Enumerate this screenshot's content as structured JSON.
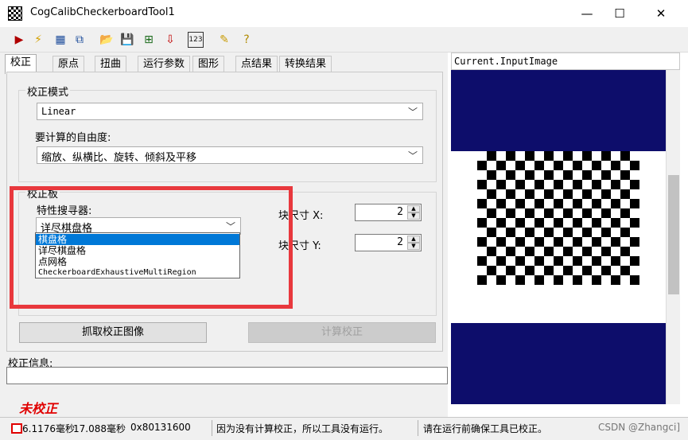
{
  "window": {
    "title": "CogCalibCheckerboardTool1",
    "minimize": "—",
    "maximize": "☐",
    "close": "✕"
  },
  "toolbar": {
    "buttons": [
      {
        "name": "run-icon",
        "glyph": "▶",
        "color": "#b00000"
      },
      {
        "name": "electric-icon",
        "glyph": "⚡",
        "color": "#d4a000"
      },
      {
        "name": "show-image-icon",
        "glyph": "▦",
        "color": "#1a4a9a"
      },
      {
        "name": "add-icon",
        "glyph": "⧉",
        "color": "#1a4a9a"
      },
      {
        "name": "open-folder-icon",
        "glyph": "📂",
        "color": "#c89a00"
      },
      {
        "name": "save-icon",
        "glyph": "💾",
        "color": "#1a1a8a"
      },
      {
        "name": "tool-graph-icon",
        "glyph": "⊞",
        "color": "#1a6a1a"
      },
      {
        "name": "import-icon",
        "glyph": "⇩",
        "color": "#c00000"
      },
      {
        "name": "counter-icon",
        "glyph": "123",
        "color": "#1a1a1a"
      },
      {
        "name": "edit-icon",
        "glyph": "✎",
        "color": "#c89a00"
      },
      {
        "name": "help-icon",
        "glyph": "?",
        "color": "#b08a00"
      }
    ]
  },
  "tabs": [
    "校正",
    "原点",
    "扭曲",
    "运行参数",
    "图形",
    "点结果",
    "转换结果"
  ],
  "calib_mode": {
    "legend": "校正模式",
    "value": "Linear",
    "dof_label": "要计算的自由度:",
    "dof_value": "缩放、纵横比、旋转、倾斜及平移"
  },
  "calib_plate": {
    "legend": "校正板",
    "feature_finder_label": "特性搜寻器:",
    "feature_finder_value": "详尽棋盘格",
    "tile_x_label": "块尺寸 X:",
    "tile_x_value": "2",
    "tile_y_label": "块尺寸 Y:",
    "tile_y_value": "2"
  },
  "dropdown_options": [
    "棋盘格",
    "详尽棋盘格",
    "点网格",
    "CheckerboardExhaustiveMultiRegion"
  ],
  "buttons": {
    "grab": "抓取校正图像",
    "compute": "计算校正"
  },
  "info": {
    "label": "校正信息:",
    "uncalibrated": "未校正"
  },
  "image_view": {
    "title": "Current.InputImage"
  },
  "status": {
    "time1": "6.1176毫秒",
    "time2": "17.088毫秒",
    "code": "0x80131600",
    "msg1": "因为没有计算校正，所以工具没有运行。",
    "msg2": "请在运行前确保工具已校正。",
    "watermark": "CSDN @Zhangci]"
  },
  "colors": {
    "highlight": "#e8383d",
    "selection": "#0078d7",
    "image_bg": "#0d0d6b",
    "uncalibrated_text": "#e00000"
  }
}
